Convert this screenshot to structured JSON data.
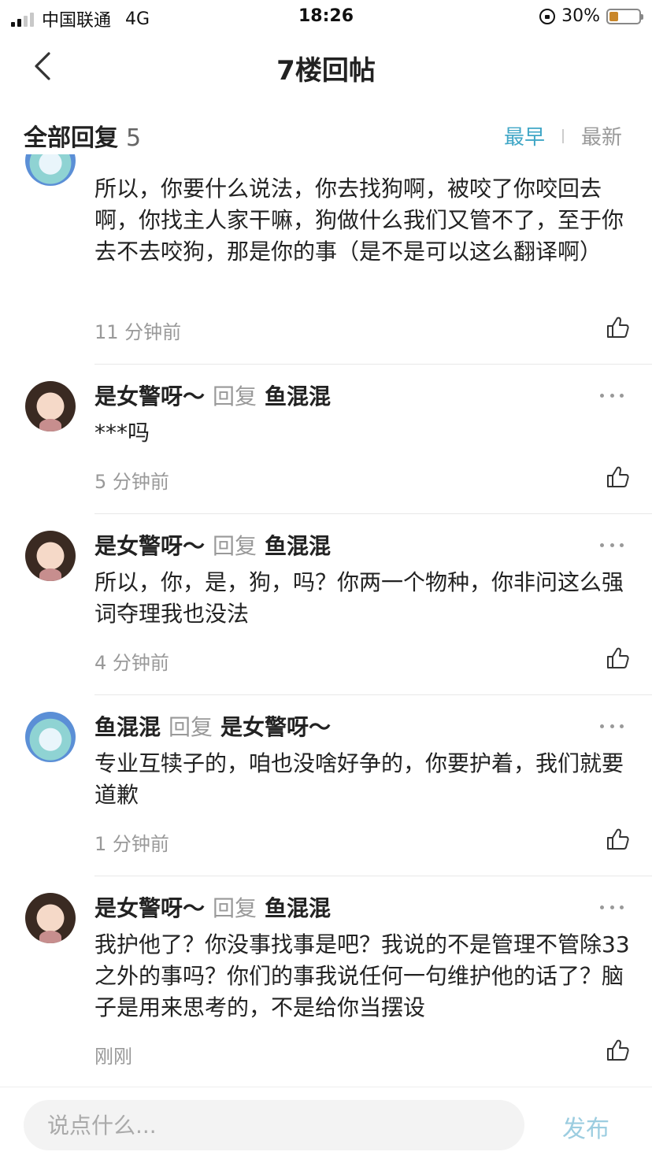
{
  "status_bar": {
    "carrier": "中国联通",
    "network": "4G",
    "time": "18:26",
    "battery": "30%",
    "battery_level": 0.3
  },
  "nav": {
    "title": "7楼回帖"
  },
  "replies_header": {
    "title": "全部回复",
    "count": "5",
    "sort_earliest": "最早",
    "sort_latest": "最新",
    "active_sort": "最早",
    "active_color": "#3fa6c6"
  },
  "comments": [
    {
      "author": "",
      "avatar": "fish-avatar",
      "body": "所以，你要什么说法，你去找狗啊，被咬了你咬回去啊，你找主人家干嘛，狗做什么我们又管不了，至于你去不去咬狗，那是你的事（是不是可以这么翻译啊）",
      "time": "11 分钟前"
    },
    {
      "author": "是女警呀～",
      "reply_word": "回复",
      "target": "鱼混混",
      "avatar": "girl-avatar",
      "body": "***吗",
      "time": "5 分钟前"
    },
    {
      "author": "是女警呀～",
      "reply_word": "回复",
      "target": "鱼混混",
      "avatar": "girl-avatar",
      "body": "所以，你，是，狗，吗？你两一个物种，你非问这么强词夺理我也没法",
      "time": "4 分钟前"
    },
    {
      "author": "鱼混混",
      "reply_word": "回复",
      "target": "是女警呀～",
      "avatar": "fish-avatar",
      "body": "专业互犊子的，咱也没啥好争的，你要护着，我们就要道歉",
      "time": "1 分钟前"
    },
    {
      "author": "是女警呀～",
      "reply_word": "回复",
      "target": "鱼混混",
      "avatar": "girl-avatar",
      "body": "我护他了？你没事找事是吧？我说的不是管理不管除33之外的事吗？你们的事我说任何一句维护他的话了？脑子是用来思考的，不是给你当摆设",
      "time": "刚刚"
    }
  ],
  "bottom_bar": {
    "input_placeholder": "说点什么...",
    "publish_label": "发布"
  }
}
